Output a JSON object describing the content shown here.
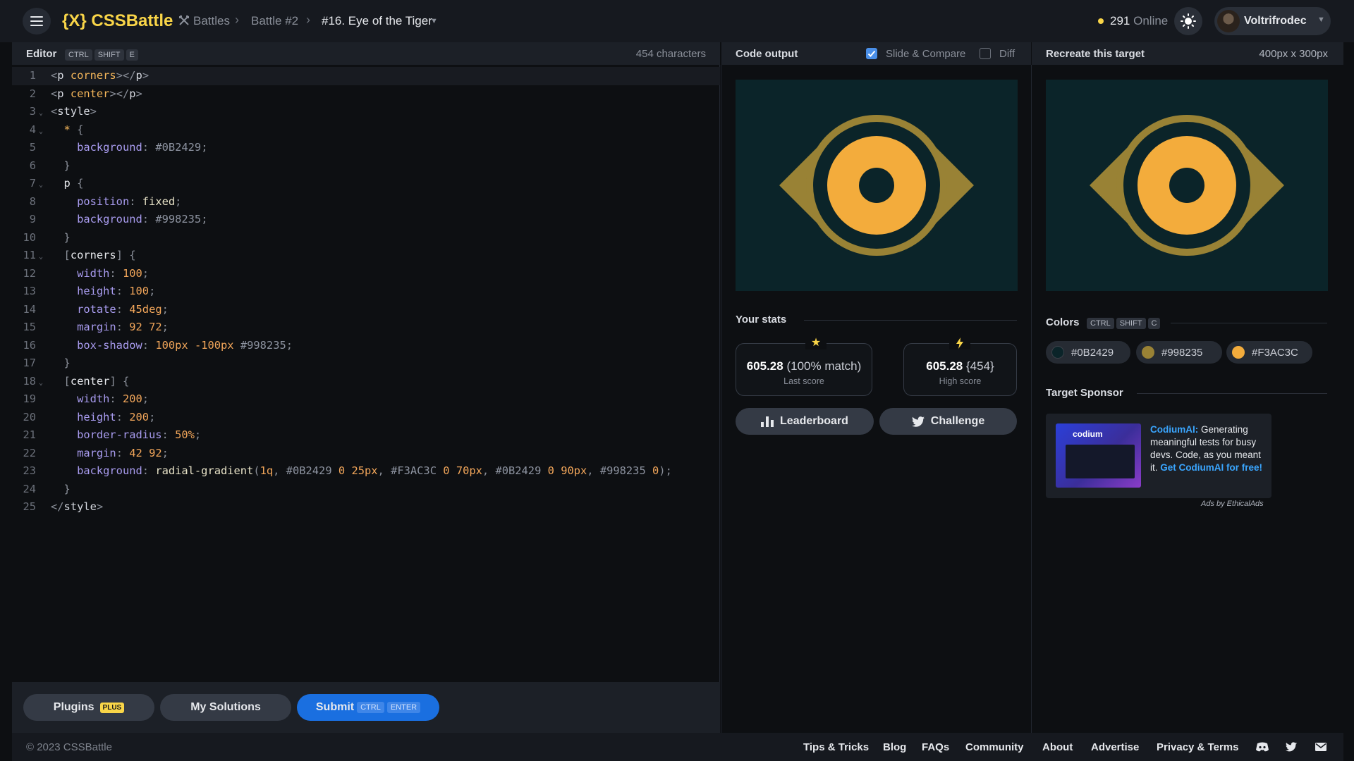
{
  "colors": {
    "bg": "#0B2429",
    "ring": "#998235",
    "pupil": "#F3AC3C",
    "brand_yellow": "#F9D548",
    "submit_blue": "#1A6FE0",
    "sponsor_link": "#3AA6FF"
  },
  "header": {
    "menu_icon": "hamburger-menu-icon",
    "logo": "{X} CSSBattle",
    "breadcrumb": {
      "battles": "Battles",
      "battles_icon": "crossed-swords-icon",
      "battle": "Battle #2",
      "current": "#16. Eye of the Tiger"
    },
    "online_count": "291",
    "online_label": "Online",
    "theme_icon": "sun-icon",
    "username": "Voltrifrodec"
  },
  "editor": {
    "title": "Editor",
    "shortcut": [
      "CTRL",
      "SHIFT",
      "E"
    ],
    "char_count": "454 characters",
    "lines": [
      "<p corners></p>",
      "<p center></p>",
      "<style>",
      "  * {",
      "    background: #0B2429;",
      "  }",
      "  p {",
      "    position: fixed;",
      "    background: #998235;",
      "  }",
      "  [corners] {",
      "    width: 100;",
      "    height: 100;",
      "    rotate: 45deg;",
      "    margin: 92 72;",
      "    box-shadow: 100px -100px #998235;",
      "  }",
      "  [center] {",
      "    width: 200;",
      "    height: 200;",
      "    border-radius: 50%;",
      "    margin: 42 92;",
      "    background: radial-gradient(1q, #0B2429 0 25px, #F3AC3C 0 70px, #0B2429 0 90px, #998235 0);",
      "  }",
      "</style>"
    ]
  },
  "buttons": {
    "plugins": "Plugins",
    "plugins_badge": "PLUS",
    "my_solutions": "My Solutions",
    "submit": "Submit",
    "submit_shortcut": [
      "CTRL",
      "ENTER"
    ],
    "leaderboard": "Leaderboard",
    "leaderboard_icon": "bar-chart-icon",
    "challenge": "Challenge",
    "challenge_icon": "twitter-bird-icon"
  },
  "output": {
    "title": "Code output",
    "slide_compare_label": "Slide & Compare",
    "slide_compare_checked": true,
    "diff_label": "Diff",
    "diff_checked": false
  },
  "target": {
    "title": "Recreate this target",
    "size": "400px x 300px"
  },
  "stats": {
    "title": "Your stats",
    "last_score_value": "605.28",
    "last_score_match": "(100% match)",
    "last_score_label": "Last score",
    "last_score_icon": "star-icon",
    "high_score_value": "605.28",
    "high_score_chars": "{454}",
    "high_score_label": "High score",
    "high_score_icon": "lightning-bolt-icon"
  },
  "colors_section": {
    "title": "Colors",
    "shortcut": [
      "CTRL",
      "SHIFT",
      "C"
    ],
    "swatches": [
      "#0B2429",
      "#998235",
      "#F3AC3C"
    ]
  },
  "sponsor": {
    "title": "Target Sponsor",
    "image_brand": "codium",
    "brand": "CodiumAI:",
    "text": " Generating meaningful tests for busy devs. Code, as you meant it. ",
    "cta": "Get CodiumAI for free!",
    "ads_by": "Ads by EthicalAds"
  },
  "footer": {
    "copyright": "© 2023 CSSBattle",
    "links": [
      "Tips & Tricks",
      "Blog",
      "FAQs",
      "Community",
      "About",
      "Advertise",
      "Privacy & Terms"
    ],
    "icons": [
      "discord-icon",
      "twitter-icon",
      "mail-icon"
    ]
  }
}
